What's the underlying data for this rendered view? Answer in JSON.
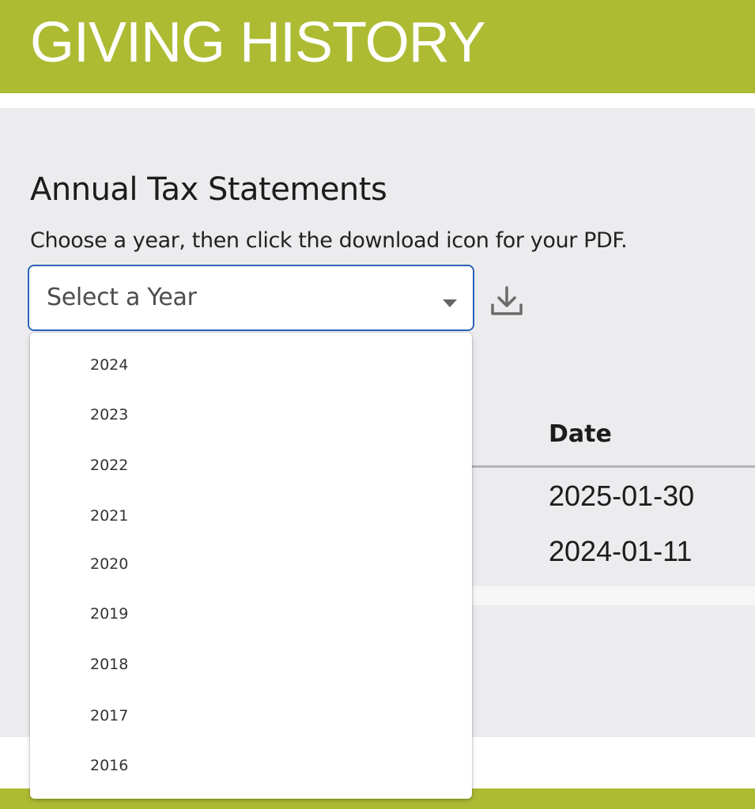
{
  "header": {
    "title": "GIVING HISTORY"
  },
  "tax_statements": {
    "title": "Annual Tax Statements",
    "description": "Choose a year, then click the download icon for your PDF.",
    "select": {
      "placeholder": "Select a Year",
      "options": [
        "2024",
        "2023",
        "2022",
        "2021",
        "2020",
        "2019",
        "2018",
        "2017",
        "2016"
      ]
    },
    "download_icon": "download-icon"
  },
  "table": {
    "columns": [
      "Date"
    ],
    "rows": [
      {
        "date": "2025-01-30"
      },
      {
        "date": "2024-01-11"
      }
    ]
  },
  "colors": {
    "brand_green": "#adbb33",
    "focus_blue": "#2b63b8",
    "panel_gray": "#ececef"
  }
}
